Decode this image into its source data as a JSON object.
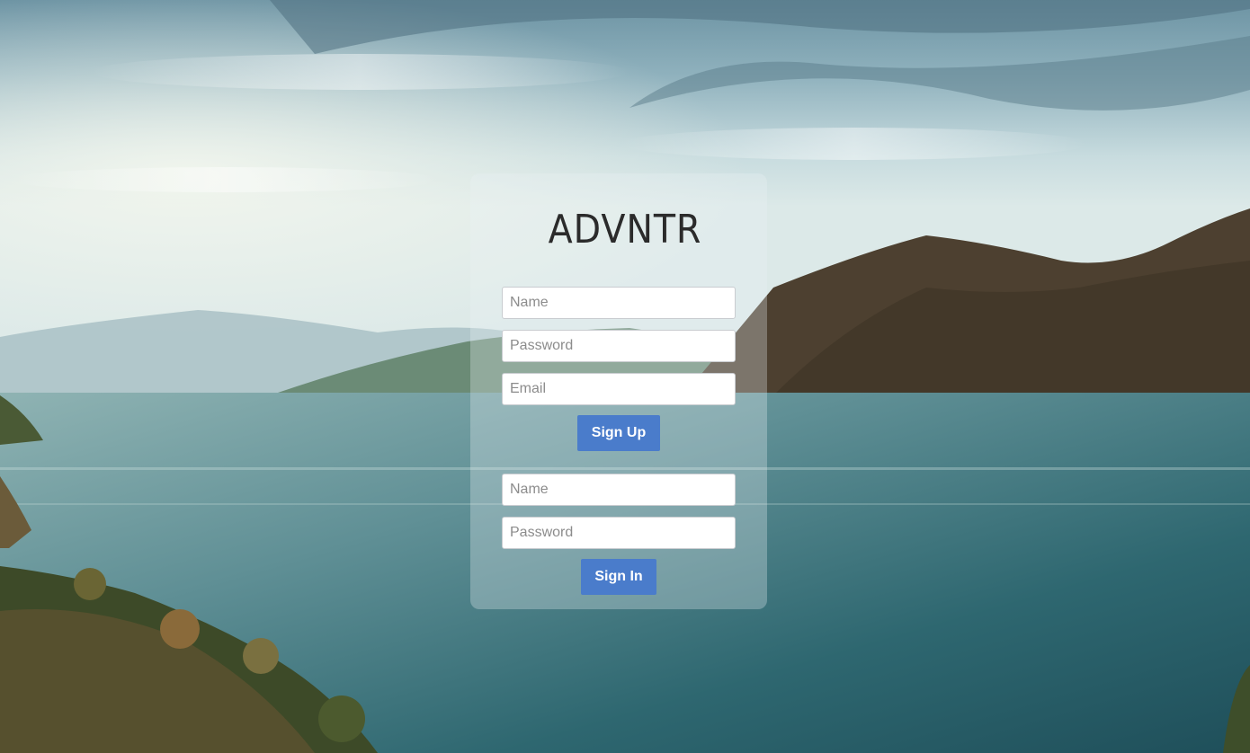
{
  "app": {
    "logo": "ADVNTR"
  },
  "signup": {
    "name_placeholder": "Name",
    "password_placeholder": "Password",
    "email_placeholder": "Email",
    "button_label": "Sign Up"
  },
  "signin": {
    "name_placeholder": "Name",
    "password_placeholder": "Password",
    "button_label": "Sign In"
  },
  "colors": {
    "button": "#4a7ccb",
    "logo_text": "#2b2b2b"
  },
  "background": {
    "scene": "lake-mountain-landscape"
  }
}
